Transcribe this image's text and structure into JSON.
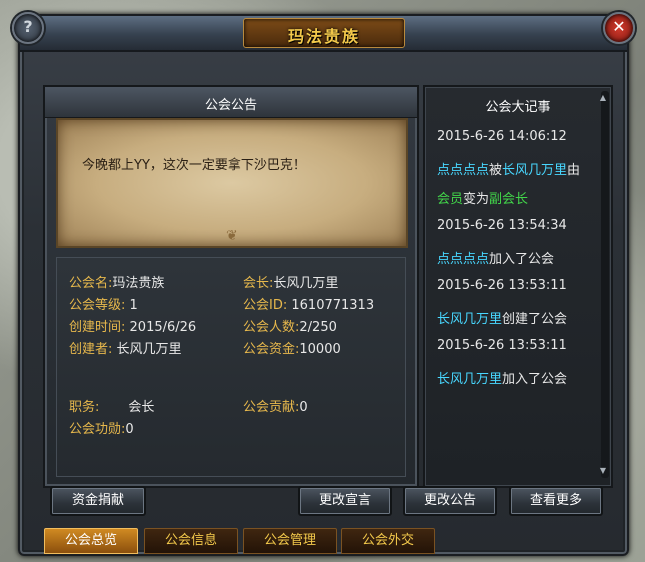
{
  "window": {
    "title": "玛法贵族"
  },
  "notice": {
    "title": "公会公告",
    "text": "今晚都上YY，这次一定要拿下沙巴克！"
  },
  "info": {
    "name_label": "公会名:",
    "name_value": "玛法贵族",
    "leader_label": "会长:",
    "leader_value": "长风几万里",
    "level_label": "公会等级:",
    "level_value": "1",
    "id_label": "公会ID:",
    "id_value": "1610771313",
    "created_label": "创建时间:",
    "created_value": "2015/6/26",
    "members_label": "公会人数:",
    "members_value": "2/250",
    "creator_label": "创建者:",
    "creator_value": "长风几万里",
    "funds_label": "公会资金:",
    "funds_value": "10000",
    "position_label": "职务:",
    "position_value": "会长",
    "contribution_label": "公会贡献:",
    "contribution_value": "0",
    "merit_label": "公会功勋:",
    "merit_value": "0"
  },
  "log": {
    "title": "公会大记事",
    "entries": [
      {
        "time": "2015-6-26 14:06:12",
        "line1_a": "点点点点",
        "line1_b": "被",
        "line1_c": "长风几万里",
        "line1_d": "由",
        "line2_a": "会员",
        "line2_b": "变为",
        "line2_c": "副会长"
      },
      {
        "time": "2015-6-26 13:54:34",
        "actor": "点点点点",
        "action": "加入了公会"
      },
      {
        "time": "2015-6-26 13:53:11",
        "actor": "长风几万里",
        "action": "创建了公会"
      },
      {
        "time": "2015-6-26 13:53:11",
        "actor": "长风几万里",
        "action": "加入了公会"
      }
    ]
  },
  "buttons": {
    "donate": "资金捐献",
    "edit_declaration": "更改宣言",
    "edit_notice": "更改公告",
    "view_more": "查看更多"
  },
  "tabs": [
    {
      "label": "公会总览",
      "active": true
    },
    {
      "label": "公会信息",
      "active": false
    },
    {
      "label": "公会管理",
      "active": false
    },
    {
      "label": "公会外交",
      "active": false
    }
  ],
  "corner": {
    "help_glyph": "?",
    "close_glyph": "✕"
  },
  "colors": {
    "label": "#e7b84c",
    "name_highlight": "#48d7ff",
    "role_highlight": "#42d64a",
    "title": "#f3c94b"
  }
}
